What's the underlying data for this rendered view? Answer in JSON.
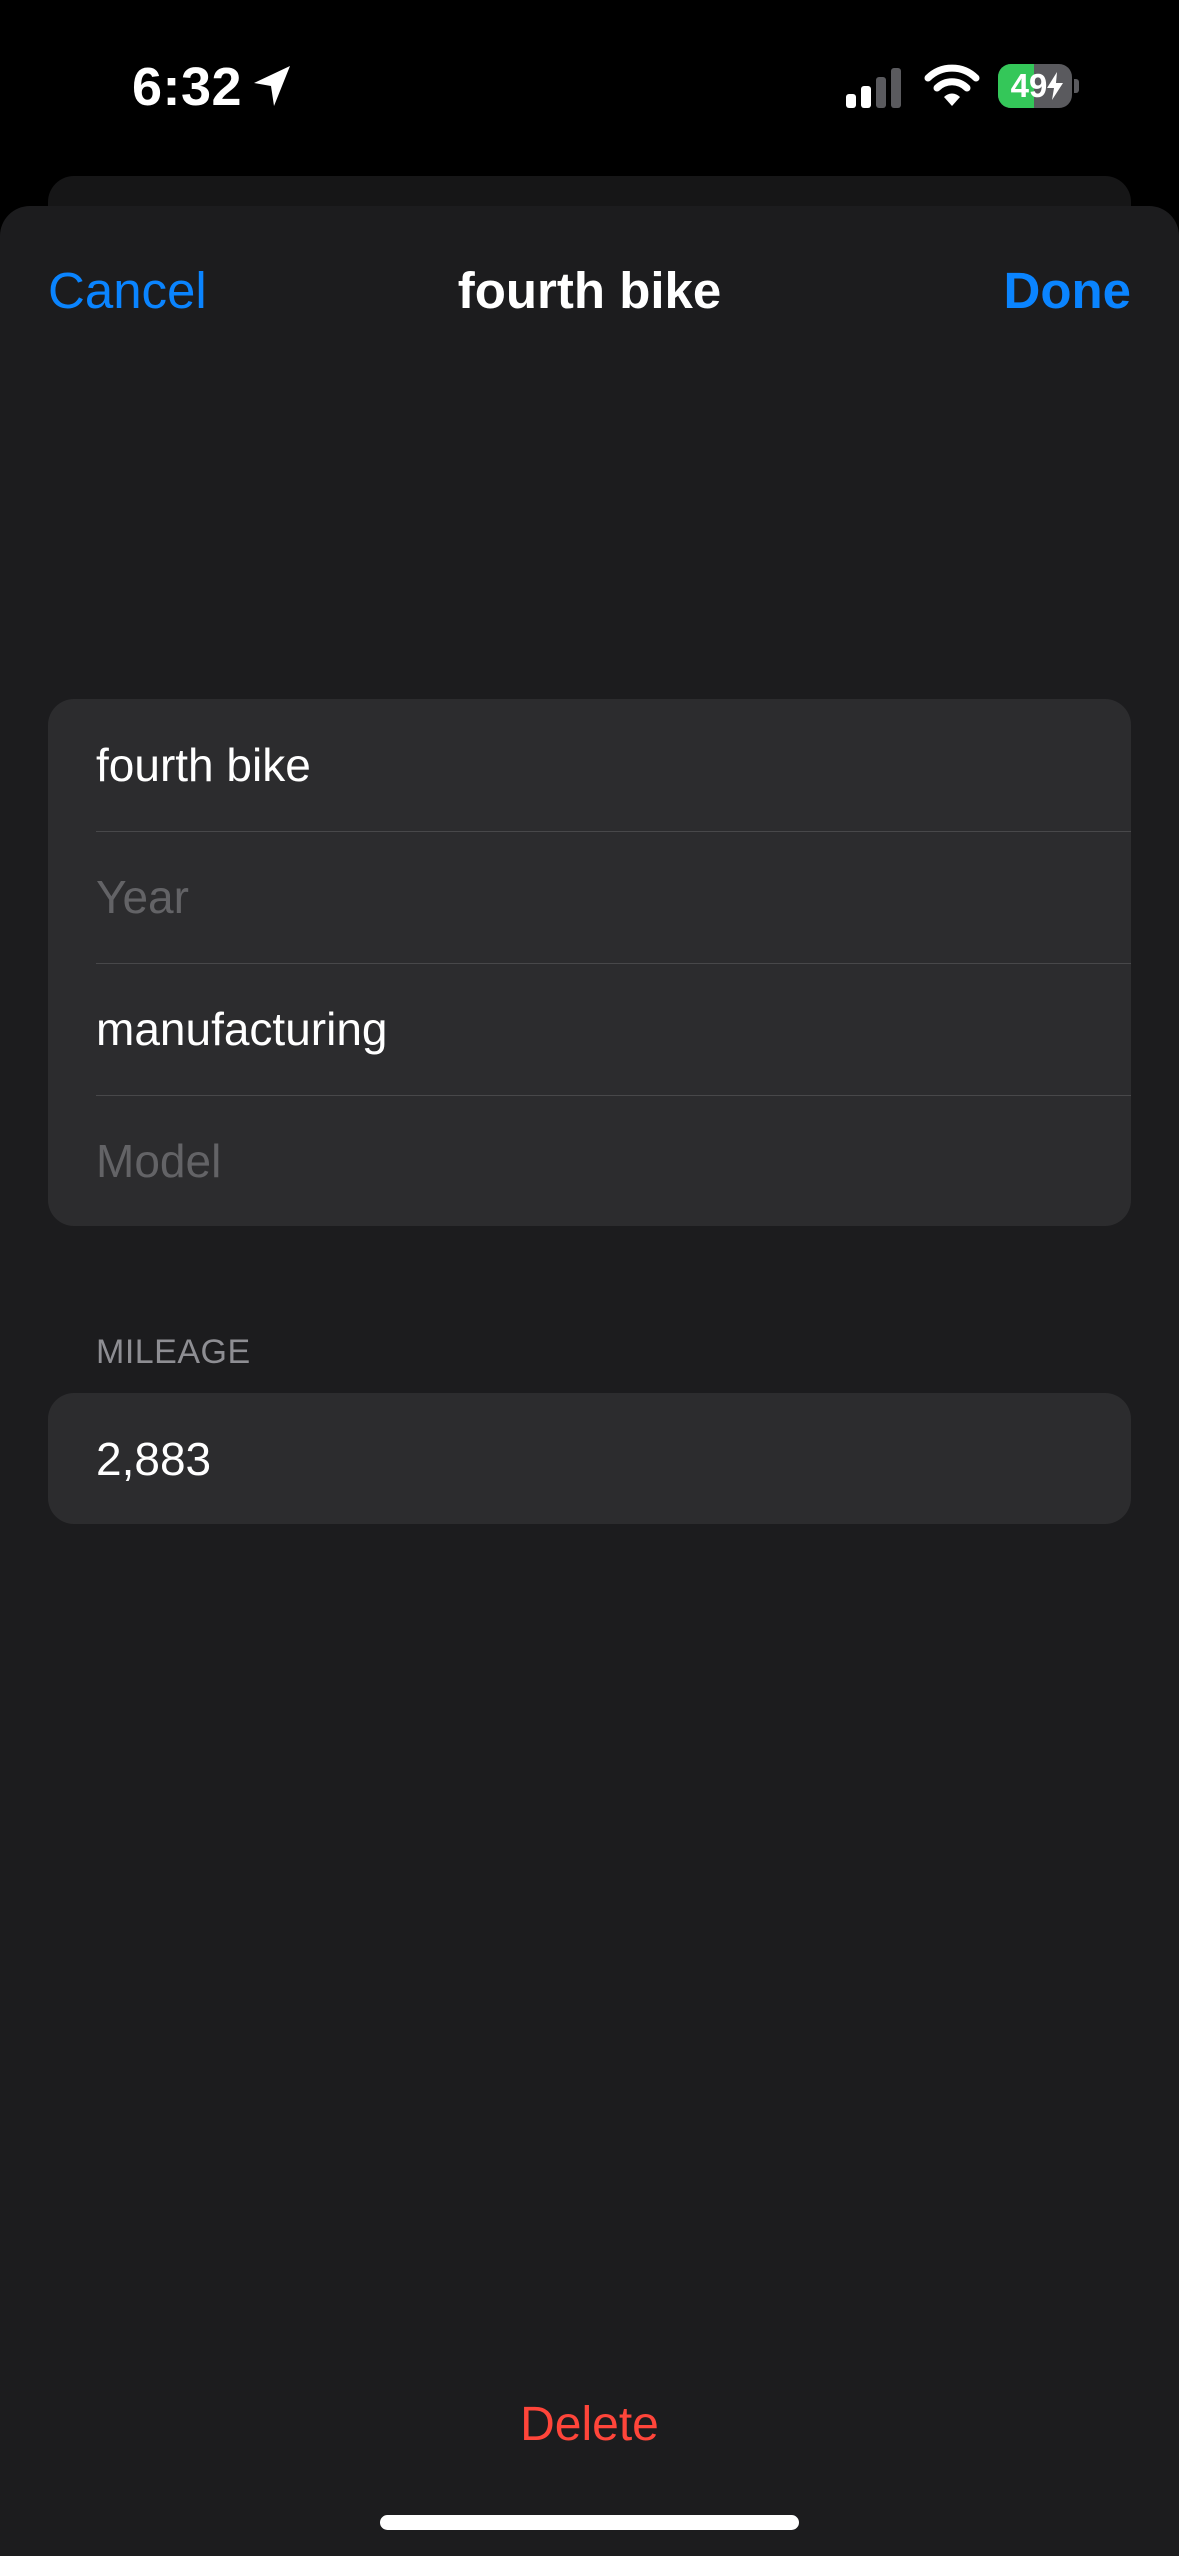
{
  "status_bar": {
    "time": "6:32",
    "battery_level": "49",
    "battery_percent": 49,
    "icons": [
      "location-arrow-icon",
      "cellular-signal-icon",
      "wifi-icon",
      "battery-charging-icon"
    ],
    "signal_bars_active": 2,
    "signal_bars_total": 4
  },
  "nav": {
    "cancel_label": "Cancel",
    "title": "fourth bike",
    "done_label": "Done"
  },
  "details": {
    "name": "fourth bike",
    "year_placeholder": "Year",
    "manufacturer": "manufacturing",
    "model_placeholder": "Model"
  },
  "mileage": {
    "header": "MILEAGE",
    "value": "2,883"
  },
  "actions": {
    "delete_label": "Delete"
  },
  "colors": {
    "accent": "#0a84ff",
    "destructive": "#ff453a",
    "battery_fill": "#34c759",
    "sheet_background": "#1c1c1e",
    "group_background": "#2c2c2e"
  }
}
